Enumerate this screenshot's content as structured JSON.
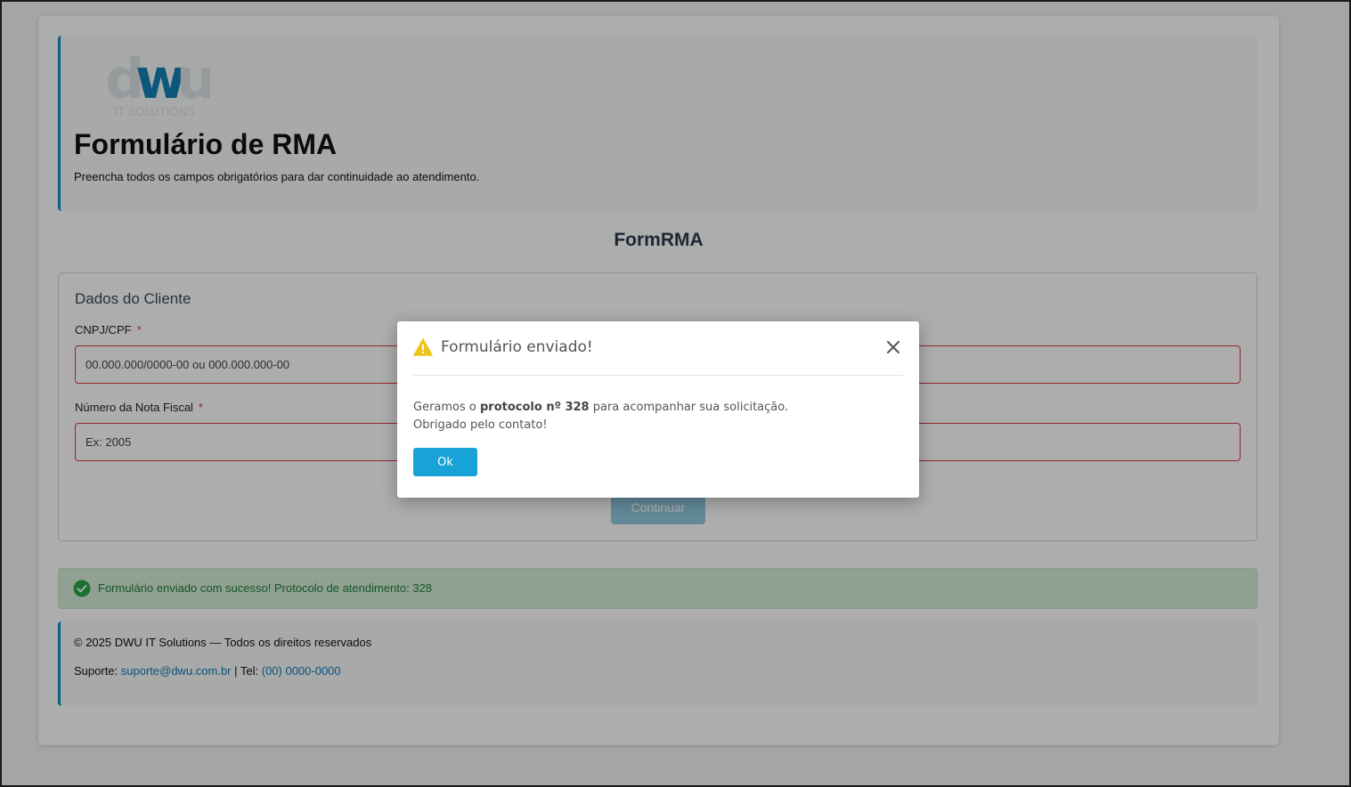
{
  "header": {
    "logo_text": "dwu",
    "logo_subtext": "IT SOLUTIONS",
    "title": "Formulário de RMA",
    "subtitle": "Preencha todos os campos obrigatórios para dar continuidade ao atendimento."
  },
  "form": {
    "heading": "FormRMA",
    "legend": "Dados do Cliente",
    "fields": [
      {
        "label": "CNPJ/CPF",
        "required_mark": "*",
        "placeholder": "00.000.000/0000-00 ou 000.000.000-00"
      },
      {
        "label": "Número da Nota Fiscal",
        "required_mark": "*",
        "placeholder": "Ex: 2005"
      }
    ],
    "submit_label": "Continuar"
  },
  "alert": {
    "text": "Formulário enviado com sucesso! Protocolo de atendimento: 328",
    "icon": "check-circle-icon"
  },
  "footer": {
    "copyright": "© 2025 DWU IT Solutions — Todos os direitos reservados",
    "support_prefix": "Suporte: ",
    "support_email": "suporte@dwu.com.br",
    "tel_prefix": " | Tel: ",
    "tel": "(00) 0000-0000"
  },
  "modal": {
    "icon": "warning-icon",
    "title": "Formulário enviado!",
    "body_prefix": "Geramos o ",
    "protocol_text": "protocolo nº 328",
    "body_suffix": " para acompanhar sua solicitação.",
    "body_line2": "Obrigado pelo contato!",
    "ok_label": "Ok",
    "close_icon": "close-icon"
  },
  "colors": {
    "accent": "#0d8fc6",
    "required": "#dc3545",
    "success_bg": "#d4edda",
    "success_text": "#1e7e34",
    "ok_button": "#17a2d8",
    "warning": "#f0c419"
  }
}
